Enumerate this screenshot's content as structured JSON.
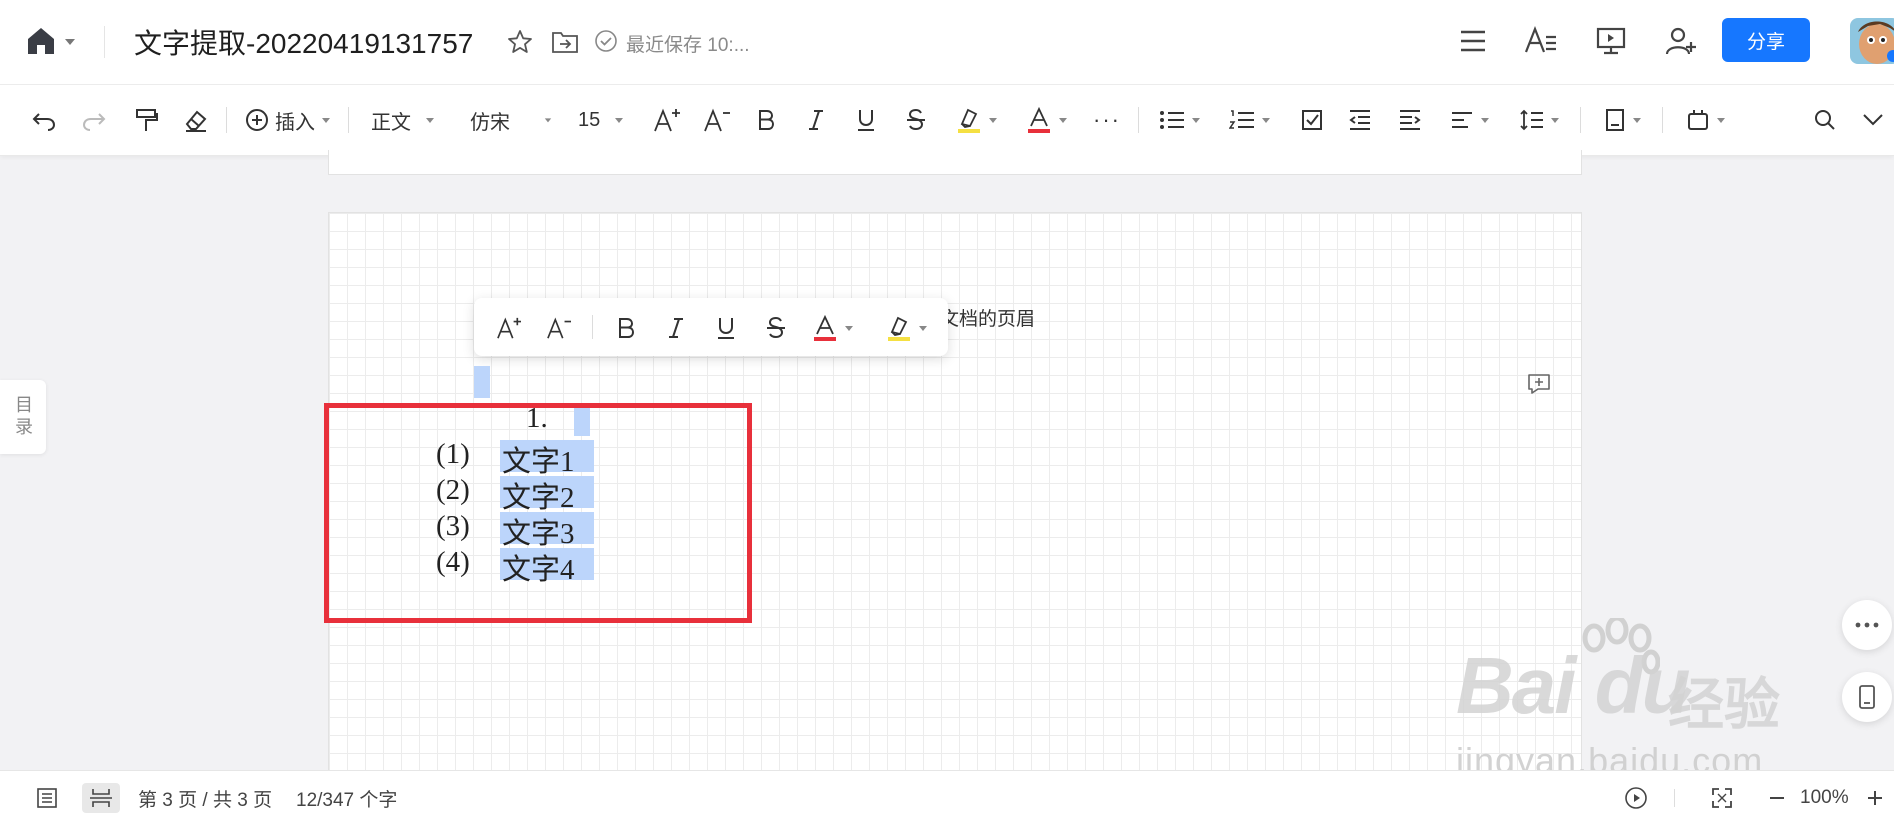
{
  "titlebar": {
    "doc_title": "文字提取-20220419131757",
    "save_status": "最近保存 10:...",
    "share_label": "分享",
    "icons": [
      "home-icon",
      "star-icon",
      "move-to-folder-icon",
      "saved-check-icon",
      "menu-icon",
      "text-style-icon",
      "presentation-icon",
      "add-collaborator-icon"
    ]
  },
  "toolbar": {
    "insert_label": "插入",
    "style_value": "正文",
    "font_value": "仿宋",
    "size_value": "15",
    "more_label": "···"
  },
  "document": {
    "header_text": "文档的页眉",
    "list_number": "1.",
    "items": [
      {
        "num": "(1)",
        "text": "文字1"
      },
      {
        "num": "(2)",
        "text": "文字2"
      },
      {
        "num": "(3)",
        "text": "文字3"
      },
      {
        "num": "(4)",
        "text": "文字4"
      }
    ],
    "toc_label": "目录"
  },
  "statusbar": {
    "page_info": "第 3 页 / 共 3 页",
    "word_count": "12/347 个字",
    "zoom": "100%"
  },
  "watermark": {
    "logo": "Bai du",
    "cn": "经验",
    "url": "jingyan.baidu.com"
  },
  "colors": {
    "accent": "#1677ff",
    "selection": "#bcd5fb",
    "highlight_box": "#e8303b",
    "font_color_red": "#e8303b",
    "highlight_yellow": "#f5e042"
  }
}
